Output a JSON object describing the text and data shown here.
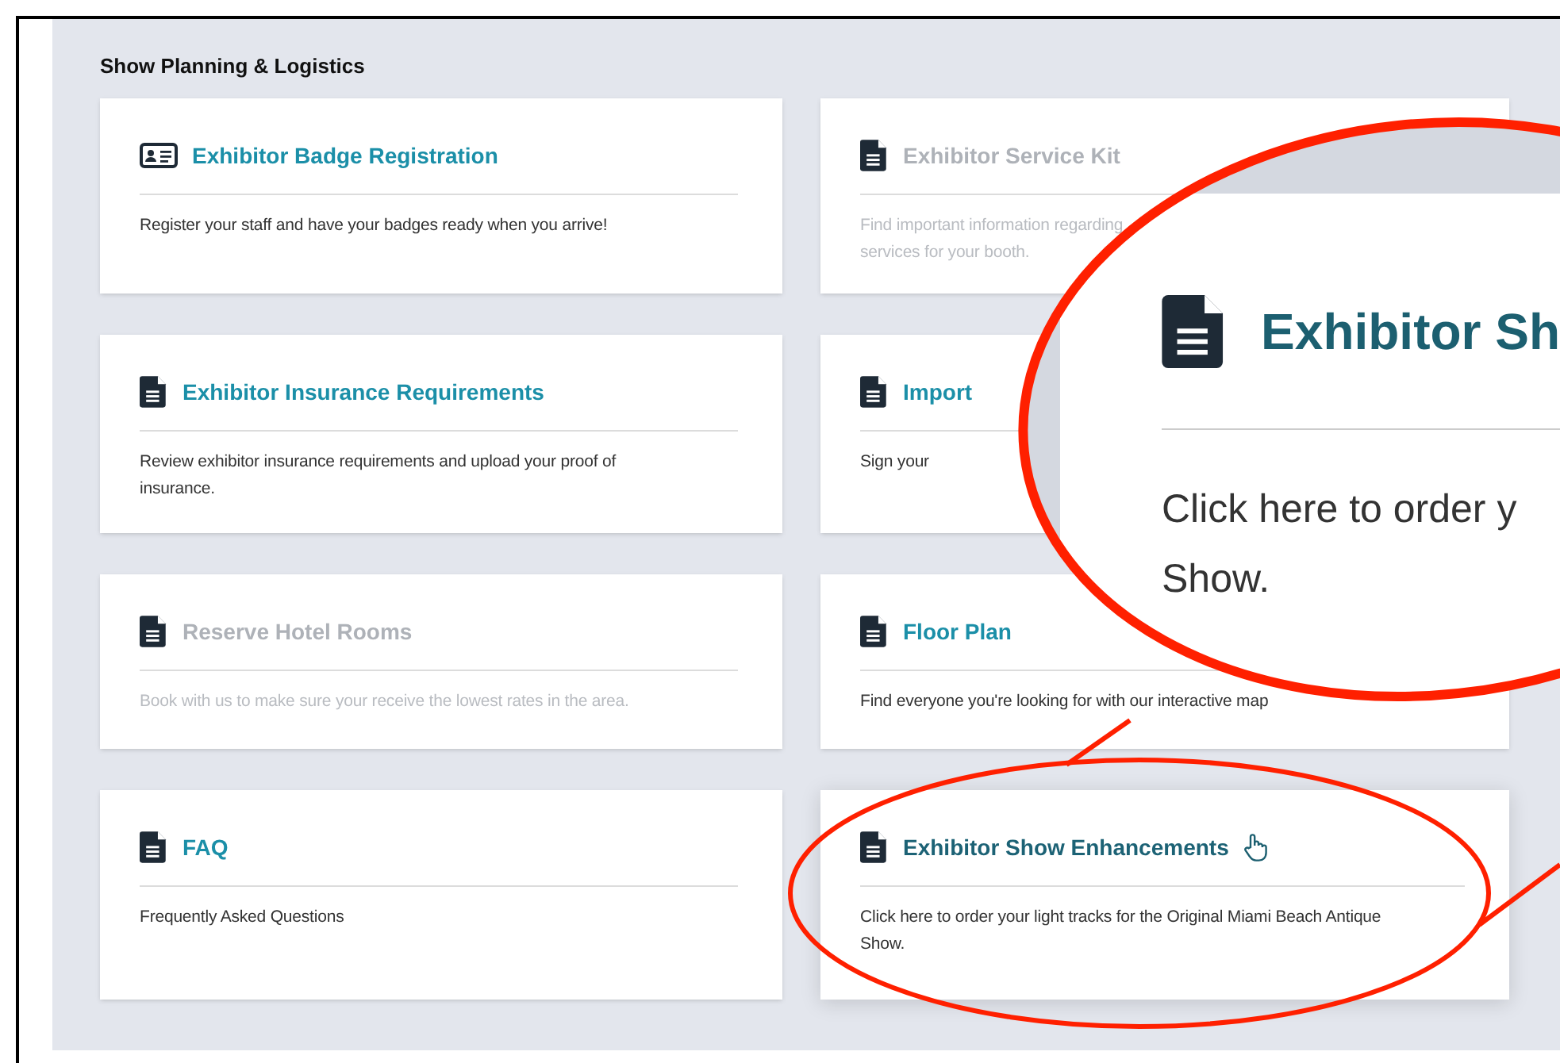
{
  "section_title": "Show Planning & Logistics",
  "cards": [
    {
      "kind": "badge",
      "title": "Exhibitor Badge Registration",
      "description": "Register your staff and have your badges ready when you arrive!",
      "disabled": false,
      "hovered": false
    },
    {
      "kind": "document",
      "title": "Exhibitor Service Kit",
      "description": "Find important information regarding",
      "description_2": "services for your booth.",
      "disabled": true,
      "hovered": false
    },
    {
      "kind": "document",
      "title": "Exhibitor Insurance Requirements",
      "description": "Review exhibitor insurance requirements and upload your proof of insurance.",
      "disabled": false,
      "hovered": false
    },
    {
      "kind": "document",
      "title": "Import",
      "description": "Sign your",
      "disabled": false,
      "hovered": false
    },
    {
      "kind": "document",
      "title": "Reserve Hotel Rooms",
      "description": "Book with us to make sure your receive the lowest rates in the area.",
      "disabled": true,
      "hovered": false
    },
    {
      "kind": "document",
      "title": "Floor Plan",
      "description": "Find everyone you're looking for with our interactive map",
      "disabled": false,
      "hovered": false
    },
    {
      "kind": "document",
      "title": "FAQ",
      "description": "Frequently Asked Questions",
      "disabled": false,
      "hovered": false
    },
    {
      "kind": "document",
      "title": "Exhibitor Show Enhancements",
      "description": "Click here to order your light tracks for the Original Miami Beach Antique Show.",
      "disabled": false,
      "hovered": true
    }
  ],
  "callout": {
    "title": "Exhibitor Sh",
    "description_lines": [
      "Click here to order y",
      "Show."
    ]
  }
}
